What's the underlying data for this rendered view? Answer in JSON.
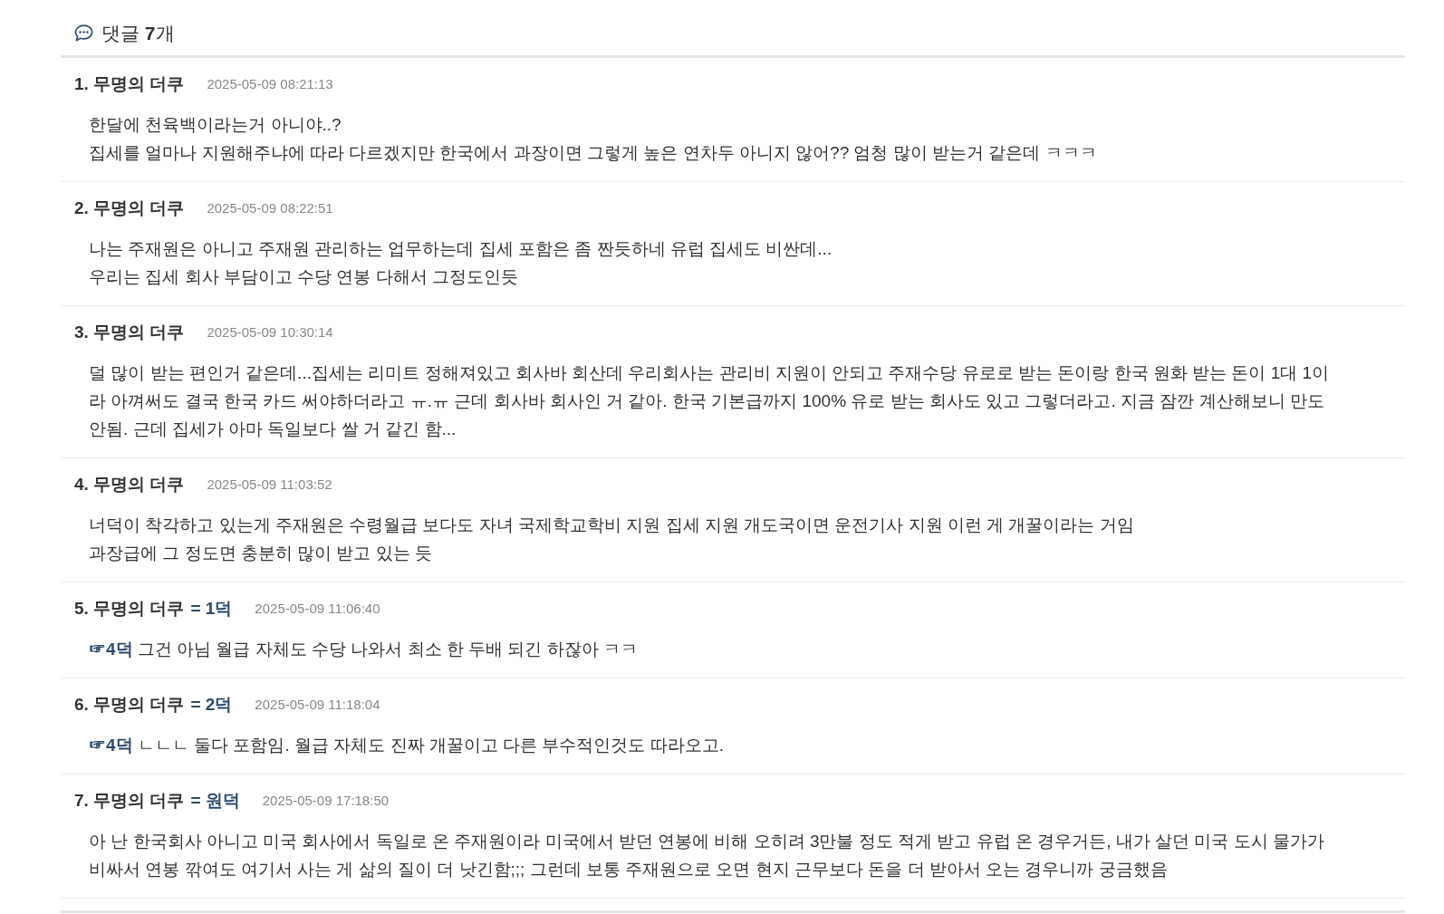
{
  "header": {
    "title": "댓글 **7**개"
  },
  "comments": [
    {
      "author": "1. 무명의 더쿠",
      "date": "2025-05-09 08:21:13",
      "lines": [
        "한달에 천육백이라는거 아니야..?",
        "집세를 얼마나 지원해주냐에 따라 다르겠지만 한국에서 과장이면 그렇게 높은 연차두 아니지 않어?? 엄청 많이 받는거 같은데 ㅋㅋㅋ"
      ]
    },
    {
      "author": "2. 무명의 더쿠",
      "date": "2025-05-09 08:22:51",
      "lines": [
        "나는 주재원은 아니고 주재원 관리하는 업무하는데 집세 포함은 좀 짠듯하네 유럽 집세도 비싼데...",
        "우리는 집세 회사 부담이고 수당 연봉 다해서 그정도인듯"
      ]
    },
    {
      "author": "3. 무명의 더쿠",
      "date": "2025-05-09 10:30:14",
      "lines": [
        "덜 많이 받는 편인거 같은데...집세는 리미트 정해져있고 회사바 회산데 우리회사는 관리비 지원이 안되고 주재수당 유로로 받는 돈이랑 한국 원화 받는 돈이 1대 1이",
        "라 아껴써도 결국 한국 카드 써야하더라고 ㅠ.ㅠ 근데 회사바 회사인 거 같아. 한국 기본급까지 100% 유로 받는 회사도 있고 그렇더라고. 지금 잠깐 계산해보니 만도",
        "안됨. 근데 집세가 아마 독일보다 쌀 거 같긴 함..."
      ]
    },
    {
      "author": "4. 무명의 더쿠",
      "date": "2025-05-09 11:03:52",
      "lines": [
        "너덕이 착각하고 있는게 주재원은 수령월급 보다도 자녀 국제학교학비 지원 집세 지원 개도국이면 운전기사 지원 이런 게 개꿀이라는 거임",
        "과장급에 그 정도면 충분히 많이 받고 있는 듯"
      ]
    },
    {
      "author": "5. 무명의 더쿠",
      "tag": "= 1덕",
      "date": "2025-05-09 11:06:40",
      "reply_to": "☞4덕",
      "lines": [
        "그건 아님 월급 자체도 수당 나와서 최소 한 두배 되긴 하잖아 ㅋㅋ"
      ]
    },
    {
      "author": "6. 무명의 더쿠",
      "tag": "= 2덕",
      "date": "2025-05-09 11:18:04",
      "reply_to": "☞4덕",
      "lines": [
        "ㄴㄴㄴ 둘다 포함임. 월급 자체도 진짜 개꿀이고 다른 부수적인것도 따라오고."
      ]
    },
    {
      "author": "7. 무명의 더쿠",
      "tag": "= 원덕",
      "date": "2025-05-09 17:18:50",
      "lines": [
        "아 난 한국회사 아니고 미국 회사에서 독일로 온 주재원이라 미국에서 받던 연봉에 비해 오히려 3만불 정도 적게 받고 유럽 온 경우거든, 내가 살던 미국 도시 물가가",
        "비싸서 연봉 깎여도 여기서 사는 게 삶의 질이 더 낫긴함;;; 그런데 보통 주재원으로 오면 현지 근무보다 돈을 더 받아서 오는 경우니까 궁금했음"
      ]
    }
  ]
}
